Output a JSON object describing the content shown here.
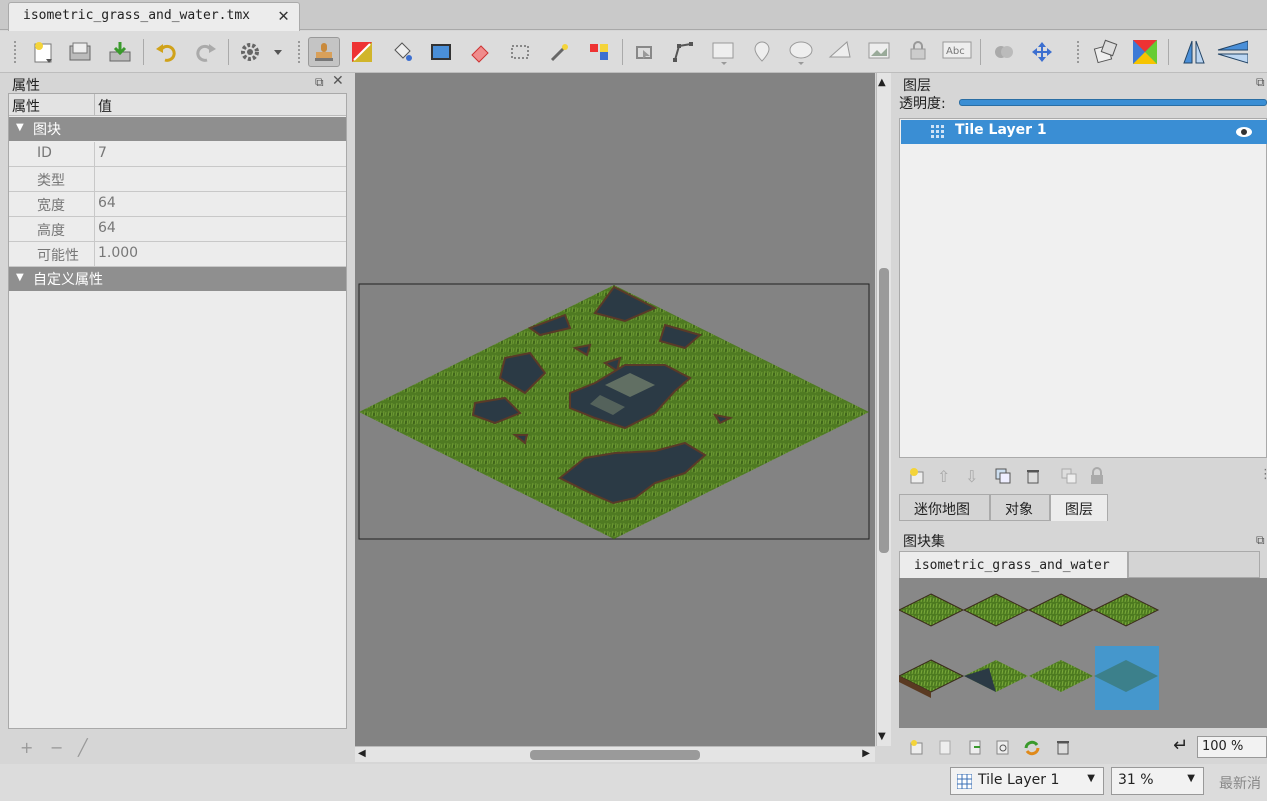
{
  "document_tab": {
    "name": "isometric_grass_and_water.tmx"
  },
  "toolbar": {
    "icons": [
      "new-map-icon",
      "open-icon",
      "save-icon",
      "undo-icon",
      "redo-icon",
      "commands-icon",
      "stamp-brush-icon",
      "terrain-brush-icon",
      "bucket-fill-icon",
      "shape-fill-icon",
      "eraser-icon",
      "rect-select-icon",
      "magic-wand-icon",
      "select-same-tile-icon",
      "select-objects-icon",
      "edit-polygons-icon",
      "insert-rect-icon",
      "insert-point-icon",
      "insert-ellipse-icon",
      "insert-polygon-icon",
      "insert-tile-icon",
      "insert-template-icon",
      "insert-text-icon",
      "world-tool-icon",
      "move-icon",
      "random-mode-icon",
      "wang-fill-icon",
      "flip-horizontal-icon",
      "flip-vertical-icon"
    ]
  },
  "properties_panel": {
    "title": "属性",
    "col_name": "属性",
    "col_value": "值",
    "group_tile": "图块",
    "rows": [
      {
        "key": "ID",
        "value": "7"
      },
      {
        "key": "类型",
        "value": ""
      },
      {
        "key": "宽度",
        "value": "64"
      },
      {
        "key": "高度",
        "value": "64"
      },
      {
        "key": "可能性",
        "value": "1.000"
      }
    ],
    "group_custom": "自定义属性"
  },
  "layers_panel": {
    "title": "图层",
    "opacity_label": "透明度:",
    "opacity": 1.0,
    "layer_name": "Tile Layer 1"
  },
  "right_tabs": [
    "迷你地图",
    "对象",
    "图层"
  ],
  "tileset_panel": {
    "title": "图块集",
    "tab": "isometric_grass_and_water",
    "zoom": "100 %"
  },
  "status_bar": {
    "layer": "Tile Layer 1",
    "zoom": "31 %",
    "news": "最新消"
  },
  "colors": {
    "accent": "#3a8ed4",
    "grass": "#4f7a22",
    "water": "#2b3a45"
  }
}
